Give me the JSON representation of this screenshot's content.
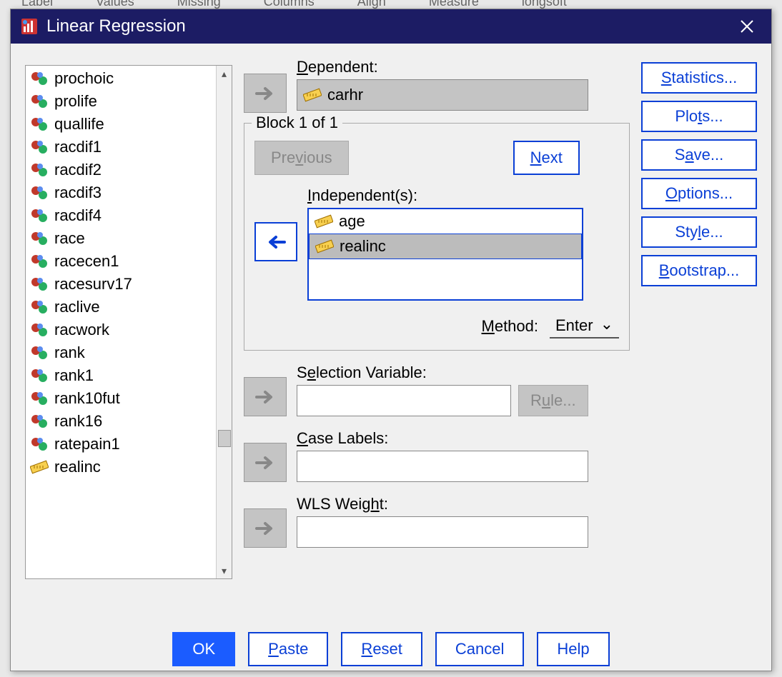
{
  "bg_headers": [
    "Label",
    "Values",
    "Missing",
    "Columns",
    "Align",
    "Measure",
    "longsoft"
  ],
  "dialog": {
    "title": "Linear Regression",
    "dependent_label": "Dependent:",
    "dependent_value": "carhr",
    "block_label": "Block 1 of 1",
    "previous": "Previous",
    "next": "Next",
    "independent_label": "Independent(s):",
    "independents": [
      {
        "name": "age",
        "type": "scale",
        "selected": false
      },
      {
        "name": "realinc",
        "type": "scale",
        "selected": true
      }
    ],
    "method_label": "Method:",
    "method_value": "Enter",
    "selection_label": "Selection Variable:",
    "rule": "Rule...",
    "case_label": "Case Labels:",
    "wls_label": "WLS Weight:"
  },
  "varlist": [
    {
      "name": "prochoic",
      "type": "nominal"
    },
    {
      "name": "prolife",
      "type": "nominal"
    },
    {
      "name": "quallife",
      "type": "nominal"
    },
    {
      "name": "racdif1",
      "type": "nominal"
    },
    {
      "name": "racdif2",
      "type": "nominal"
    },
    {
      "name": "racdif3",
      "type": "nominal"
    },
    {
      "name": "racdif4",
      "type": "nominal"
    },
    {
      "name": "race",
      "type": "nominal"
    },
    {
      "name": "racecen1",
      "type": "nominal"
    },
    {
      "name": "racesurv17",
      "type": "nominal"
    },
    {
      "name": "raclive",
      "type": "nominal"
    },
    {
      "name": "racwork",
      "type": "nominal"
    },
    {
      "name": "rank",
      "type": "nominal"
    },
    {
      "name": "rank1",
      "type": "nominal"
    },
    {
      "name": "rank10fut",
      "type": "nominal"
    },
    {
      "name": "rank16",
      "type": "nominal"
    },
    {
      "name": "ratepain1",
      "type": "nominal"
    },
    {
      "name": "realinc",
      "type": "scale"
    }
  ],
  "side_buttons": {
    "statistics": "Statistics...",
    "plots": "Plots...",
    "save": "Save...",
    "options": "Options...",
    "style": "Style...",
    "bootstrap": "Bootstrap..."
  },
  "bottom": {
    "ok": "OK",
    "paste": "Paste",
    "reset": "Reset",
    "cancel": "Cancel",
    "help": "Help"
  }
}
